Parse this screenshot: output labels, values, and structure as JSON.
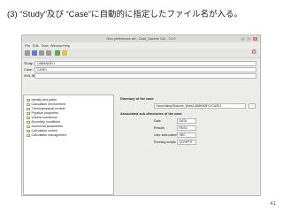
{
  "slide": {
    "title": "(3) “Study”及び “Case”に自動的に指定したファイル名が入る。",
    "page_number": "41"
  },
  "window": {
    "title": "New preferences set - Code_Saturne GUI - 3.0.0",
    "menu": [
      "File",
      "Edit",
      "Tools",
      "Window",
      "Help"
    ],
    "study_label": "Study:",
    "study_value": "LABMSKBY1",
    "case_label": "Case:",
    "case_value": "CASE1",
    "xml_label": "XML file:",
    "xml_value": ""
  },
  "tree": {
    "items": [
      {
        "label": "Identity and paths",
        "selected": true
      },
      {
        "label": "Calculation environment"
      },
      {
        "label": "Thermophysical models"
      },
      {
        "label": "Physical properties"
      },
      {
        "label": "Volume conditions"
      },
      {
        "label": "Boundary conditions"
      },
      {
        "label": "Numerical parameters"
      },
      {
        "label": "Calculation control"
      },
      {
        "label": "Calculation management"
      }
    ]
  },
  "panel": {
    "dir_title": "Directory of the case",
    "dir_value": "/home/labuji/Saturne_Work/LABMSKBY1/CASE1",
    "browse_label": "...",
    "sub_title": "Associated sub-directories of the case",
    "subdirs": [
      {
        "label": "Data",
        "value": "DATA"
      },
      {
        "label": "Results",
        "value": "RESU"
      },
      {
        "label": "User subroutines",
        "value": "SRC"
      },
      {
        "label": "Running scripts",
        "value": "SCRIPTS"
      }
    ]
  }
}
